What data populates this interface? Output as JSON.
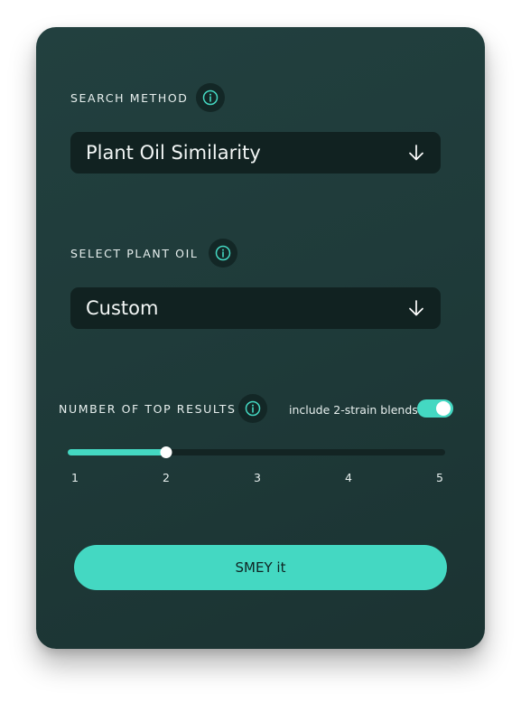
{
  "search_method": {
    "label": "SEARCH METHOD",
    "selected": "Plant Oil Similarity"
  },
  "plant_oil": {
    "label": "SELECT PLANT OIL",
    "selected": "Custom"
  },
  "top_results": {
    "label": "NUMBER OF TOP RESULTS",
    "toggle_label": "include 2-strain blends",
    "toggle_on": true,
    "slider_min": 1,
    "slider_max": 5,
    "slider_value": 2,
    "ticks": [
      "1",
      "2",
      "3",
      "4",
      "5"
    ]
  },
  "submit_label": "SMEY it",
  "colors": {
    "accent": "#44d8c2",
    "card_bg": "#1f3b3a",
    "field_bg": "#112221"
  },
  "icons": {
    "info": "info-circle-icon",
    "select_arrow": "arrow-down-icon"
  }
}
